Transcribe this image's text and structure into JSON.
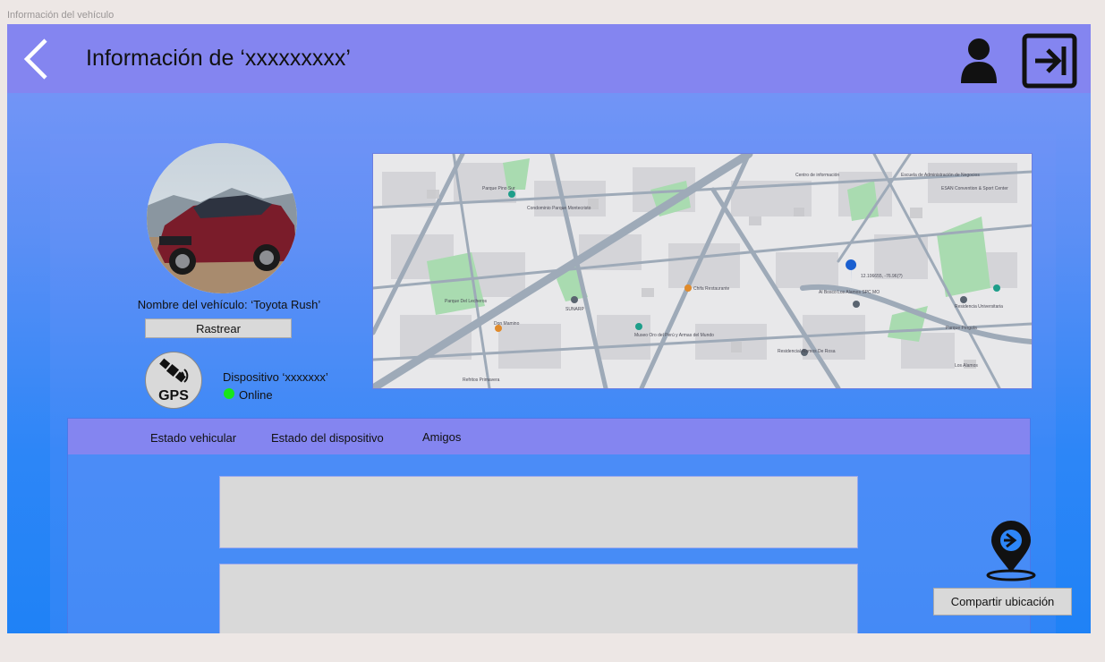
{
  "window": {
    "label": "Información del vehículo"
  },
  "header": {
    "title": "Información de ‘xxxxxxxxx’",
    "back_icon": "chevron-left-icon",
    "user_icon": "user-icon",
    "logout_icon": "logout-icon"
  },
  "vehicle": {
    "name_label": "Nombre del vehículo: ‘Toyota Rush’",
    "track_button": "Rastrear"
  },
  "device": {
    "icon_label": "GPS",
    "name": "Dispositivo ‘xxxxxxx’",
    "status": "Online",
    "status_color": "#18e51a"
  },
  "map": {
    "labels": [
      "Parque Pino Sur",
      "Condominio Parque Montecristo",
      "Centro de información",
      "Escuela de Administración de Negocios",
      "ESAN Convention & Sport Center",
      "Chifa Restaurante",
      "Parque Del Lecheros",
      "Don Mamino",
      "SUNARP",
      "Museo Oro del Perú y Armas del Mundo",
      "12.106655, -76.96(?)",
      "Al Bosco Los Alamos SPC MO",
      "Residencia Universitaria",
      "Parque Pergola",
      "Residencial Alamos De Rosa",
      "Los Alamos",
      "Refritos Primavera"
    ],
    "marker_color": "#1a5fd0"
  },
  "tabs": [
    {
      "label": "Estado vehicular"
    },
    {
      "label": "Estado del dispositivo"
    },
    {
      "label": "Amigos"
    }
  ],
  "share": {
    "icon": "location-share-icon",
    "button": "Compartir ubicación"
  },
  "colors": {
    "header": "#8485f0",
    "background": "#ede7e5",
    "field": "#d9d9d9"
  }
}
